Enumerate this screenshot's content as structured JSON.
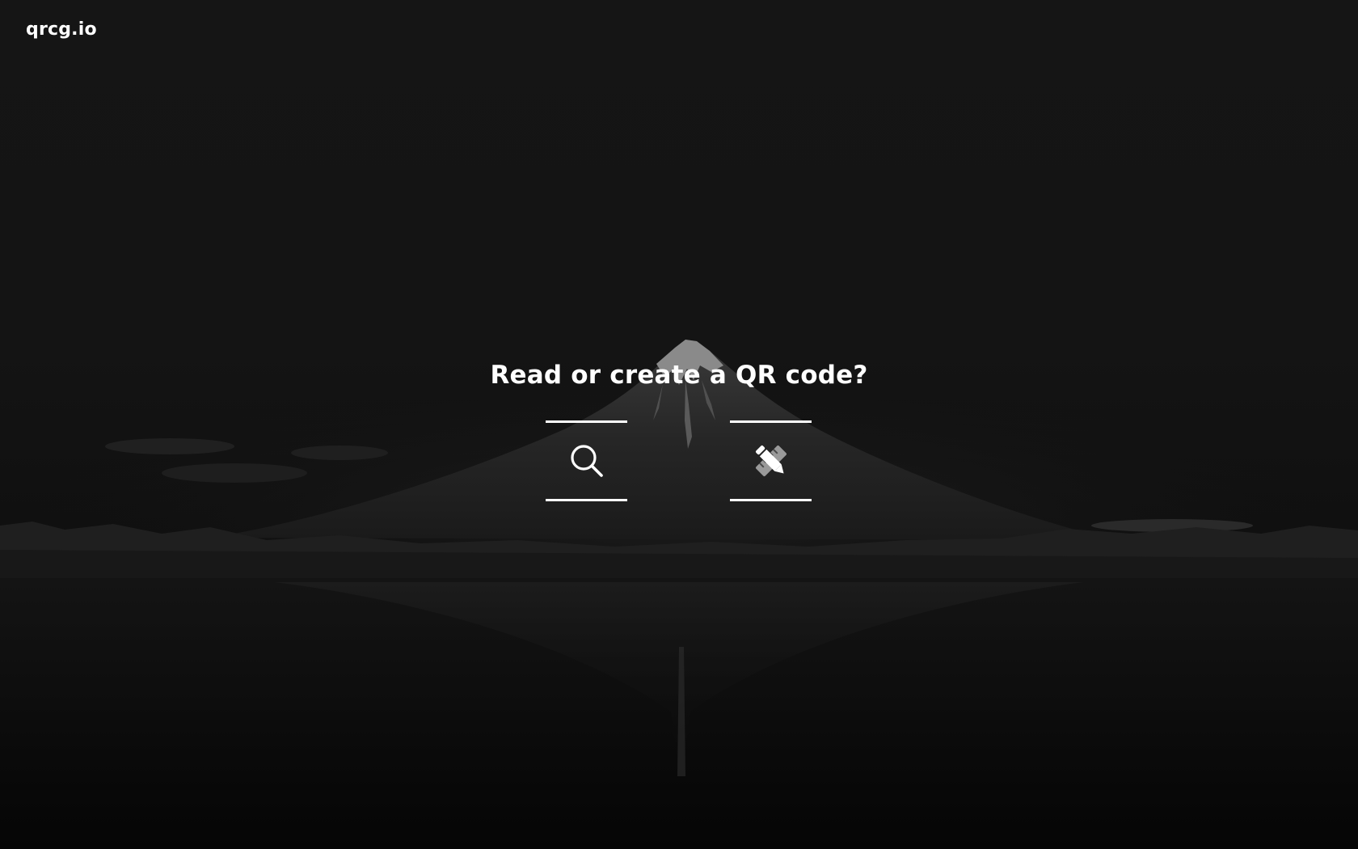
{
  "header": {
    "logo_text": "qrcg.io"
  },
  "main": {
    "headline": "Read or create a QR code?",
    "options": [
      {
        "action": "read",
        "icon": "search-icon"
      },
      {
        "action": "create",
        "icon": "pencil-ruler-icon"
      }
    ]
  },
  "colors": {
    "background": "#121212",
    "text": "#ffffff",
    "accent_lines": "#ffffff"
  }
}
